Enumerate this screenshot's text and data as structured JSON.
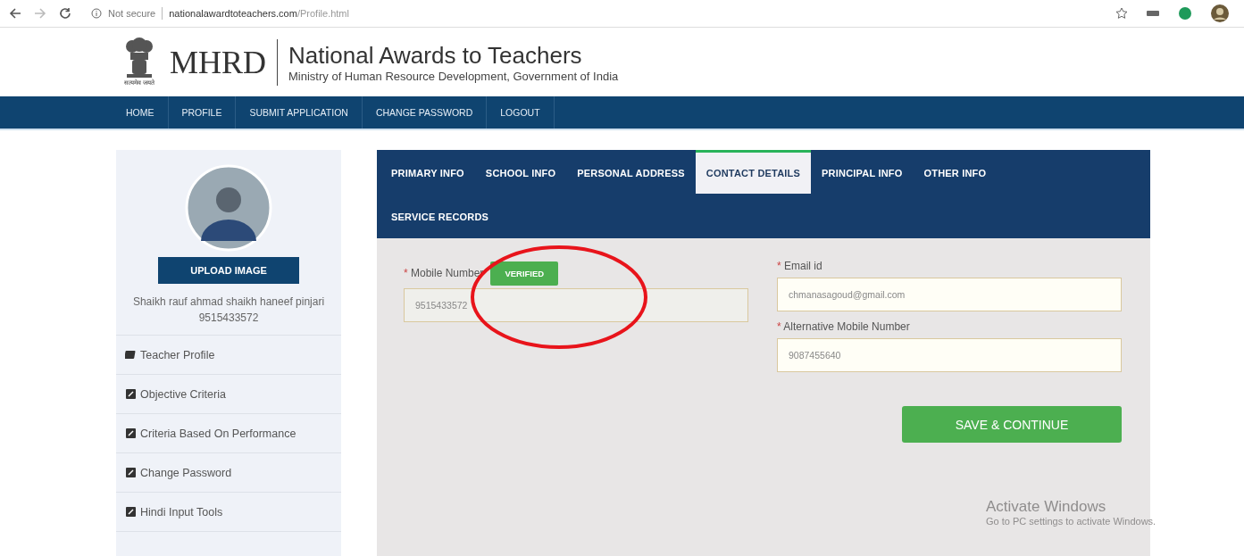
{
  "browser": {
    "security": "Not secure",
    "url_host": "nationalawardtoteachers.com",
    "url_path": "/Profile.html"
  },
  "header": {
    "logo_caption": "सत्यमेव जयते",
    "brand": "MHRD",
    "title": "National Awards to Teachers",
    "subtitle": "Ministry of Human Resource Development, Government of India"
  },
  "nav": [
    "HOME",
    "PROFILE",
    "SUBMIT APPLICATION",
    "CHANGE PASSWORD",
    "LOGOUT"
  ],
  "sidebar": {
    "upload_button": "UPLOAD IMAGE",
    "name": "Shaikh rauf ahmad shaikh haneef pinjari",
    "phone": "9515433572",
    "items": [
      {
        "label": "Teacher Profile",
        "kind": "book"
      },
      {
        "label": "Objective Criteria",
        "kind": "edit"
      },
      {
        "label": "Criteria Based On Performance",
        "kind": "edit"
      },
      {
        "label": "Change Password",
        "kind": "edit"
      },
      {
        "label": "Hindi Input Tools",
        "kind": "edit"
      }
    ]
  },
  "tabs": [
    {
      "label": "PRIMARY INFO",
      "selected": false
    },
    {
      "label": "SCHOOL INFO",
      "selected": false
    },
    {
      "label": "PERSONAL ADDRESS",
      "selected": false
    },
    {
      "label": "CONTACT DETAILS",
      "selected": true
    },
    {
      "label": "PRINCIPAL INFO",
      "selected": false
    },
    {
      "label": "OTHER INFO",
      "selected": false
    },
    {
      "label": "SERVICE RECORDS",
      "selected": false
    }
  ],
  "form": {
    "mobile": {
      "required_mark": "*",
      "label": "Mobile Number",
      "badge": "VERIFIED",
      "value": "9515433572",
      "disabled": true
    },
    "email": {
      "required_mark": "*",
      "label": "Email id",
      "value": "chmanasagoud@gmail.com"
    },
    "alt_mobile": {
      "required_mark": "*",
      "label": "Alternative Mobile Number",
      "value": "9087455640"
    },
    "save_button": "SAVE & CONTINUE"
  },
  "activation_notice": {
    "title": "Activate Windows",
    "text": "Go to PC settings to activate Windows."
  }
}
